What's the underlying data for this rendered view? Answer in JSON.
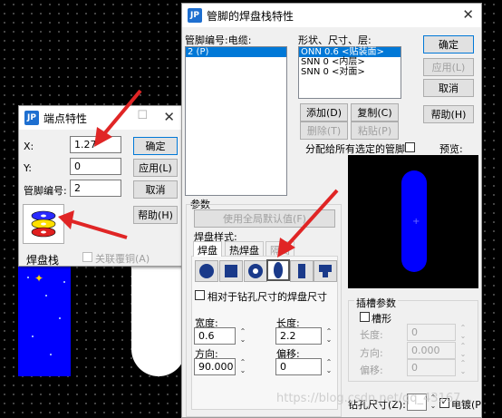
{
  "canvas": {
    "background": "#000000",
    "pad_blue": "#0000ff"
  },
  "small_dialog": {
    "title": "端点特性",
    "fields": [
      {
        "label": "X:",
        "value": "1.27"
      },
      {
        "label": "Y:",
        "value": "0"
      },
      {
        "label": "管脚编号:",
        "value": "2"
      }
    ],
    "buttons": {
      "ok": "确定",
      "apply": "应用(L)",
      "cancel": "取消",
      "help": "帮助(H)"
    },
    "padstack_button_label": "焊盘栈",
    "associate_copper_label": "关联覆铜(A)"
  },
  "main_dialog": {
    "title": "管脚的焊盘栈特性",
    "pin_list_header": "管脚编号:电缆:",
    "pin_items": [
      "2 (P)"
    ],
    "shape_header": "形状、尺寸、层:",
    "shape_items": [
      "ONN 0.6 <贴装面>",
      "SNN 0 <内层>",
      "SNN 0 <对面>"
    ],
    "buttons": {
      "ok": "确定",
      "apply": "应用(L)",
      "cancel": "取消",
      "help": "帮助(H)",
      "add": "添加(D)",
      "copy": "复制(C)",
      "delete": "删除(T)",
      "paste": "粘贴(P)"
    },
    "assign_all_label": "分配给所有选定的管脚",
    "preview_label": "预览:",
    "params_label": "参数",
    "use_defaults_label": "使用全局默认值(F)",
    "pad_style_label": "焊盘样式:",
    "tabs": [
      "焊盘",
      "热焊盘",
      "隔离"
    ],
    "shape_buttons": [
      "round-pad-icon",
      "square-pad-icon",
      "annular-pad-icon",
      "oval-pad-icon",
      "rect-finger-icon",
      "custom-pad-icon"
    ],
    "relative_drill_label": "相对于钻孔尺寸的焊盘尺寸",
    "width_label": "宽度:",
    "width_value": "0.6",
    "length_label": "长度:",
    "length_value": "2.2",
    "orientation_label": "方向:",
    "orientation_value": "90.000",
    "offset_label": "偏移:",
    "offset_value": "0",
    "slot_group_label": "插槽参数",
    "slot_chk_label": "槽形",
    "slot_length_label": "长度:",
    "slot_length_value": "0",
    "slot_orient_label": "方向:",
    "slot_orient_value": "0.000",
    "slot_offset_label": "偏移:",
    "slot_offset_value": "0",
    "drill_size_label": "钻孔尺寸(Z):",
    "plated_label": "电镀(P)"
  },
  "watermark": "https://blog.csdn.net/qq_43167"
}
